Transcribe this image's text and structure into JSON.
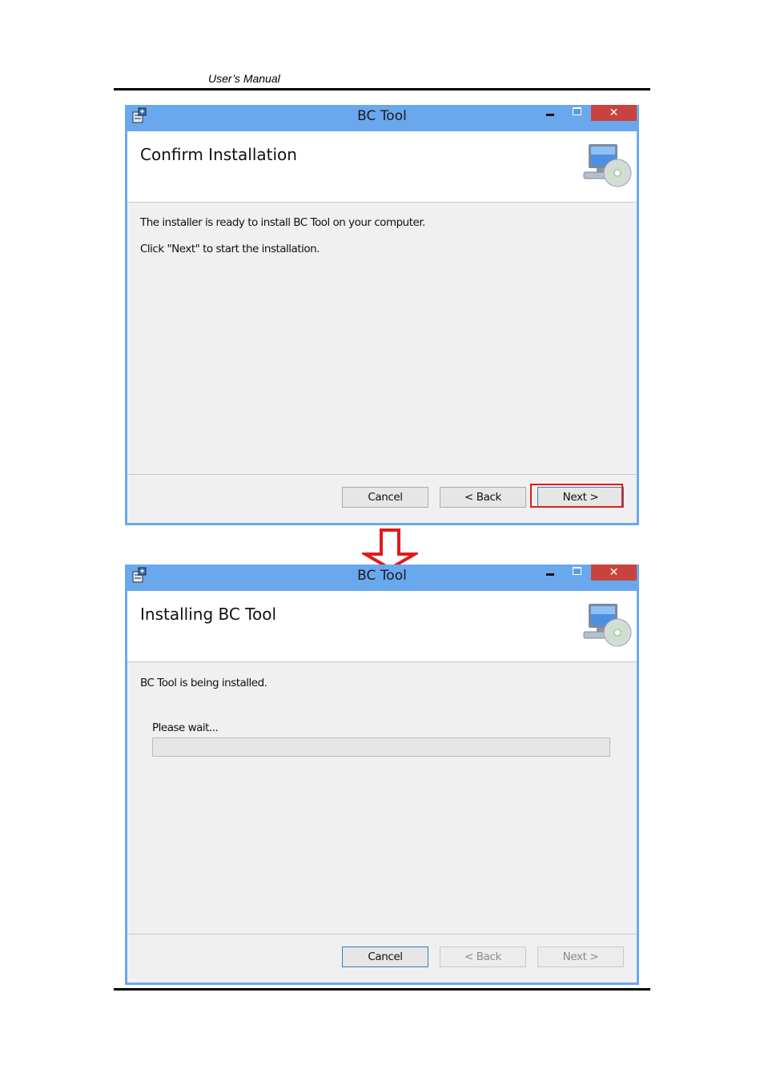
{
  "document": {
    "header": "User’s Manual"
  },
  "windows": [
    {
      "title": "BC Tool",
      "close_glyph": "✕",
      "banner_title": "Confirm Installation",
      "body_lines": [
        "The installer is ready to install BC Tool on your computer.",
        "Click \"Next\" to start the installation."
      ],
      "buttons": {
        "cancel": "Cancel",
        "back": "< Back",
        "next": "Next >"
      },
      "highlight_color": "#e01b1b"
    },
    {
      "title": "BC Tool",
      "close_glyph": "✕",
      "banner_title": "Installing BC Tool",
      "body_lines": [
        "BC Tool is being installed."
      ],
      "progress": {
        "label": "Please wait...",
        "value": 0
      },
      "buttons": {
        "cancel": "Cancel",
        "back": "< Back",
        "next": "Next >"
      }
    }
  ],
  "colors": {
    "titlebar": "#6aa8ee",
    "close_button": "#c9433e",
    "arrow": "#e01b1b"
  },
  "icons": {
    "app": "installer-package-icon",
    "banner": "computer-cd-icon",
    "arrow": "down-arrow-icon"
  }
}
